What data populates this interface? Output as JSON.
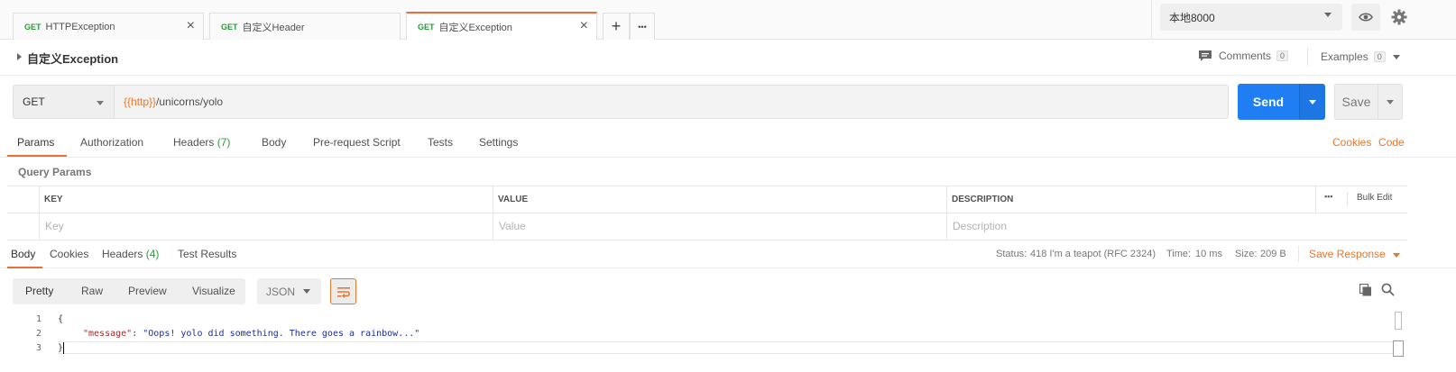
{
  "tabs": [
    {
      "method": "GET",
      "name": "HTTPException",
      "close": "×"
    },
    {
      "method": "GET",
      "name": "自定义Header"
    },
    {
      "method": "GET",
      "name": "自定义Exception",
      "close": "×"
    }
  ],
  "tab_controls": {
    "add": "+",
    "more": "•••"
  },
  "environment": {
    "selected": "本地8000"
  },
  "request": {
    "title": "自定义Exception",
    "comments_label": "Comments",
    "comments_count": "0",
    "examples_label": "Examples",
    "examples_count": "0",
    "method": "GET",
    "url_var": "{{http}}",
    "url_path": "/unicorns/yolo",
    "send_label": "Send",
    "save_label": "Save"
  },
  "request_tabs": {
    "params": "Params",
    "authorization": "Authorization",
    "headers": "Headers",
    "headers_count": "(7)",
    "body": "Body",
    "prerequest": "Pre-request Script",
    "tests": "Tests",
    "settings": "Settings",
    "cookies": "Cookies",
    "code": "Code"
  },
  "query_params": {
    "label": "Query Params",
    "columns": [
      "KEY",
      "VALUE",
      "DESCRIPTION"
    ],
    "placeholders": [
      "Key",
      "Value",
      "Description"
    ],
    "more": "•••",
    "bulk_edit": "Bulk Edit"
  },
  "response_tabs": {
    "body": "Body",
    "cookies": "Cookies",
    "headers": "Headers",
    "headers_count": "(4)",
    "test_results": "Test Results"
  },
  "response_status": {
    "status_label": "Status:",
    "status_value": "418 I'm a teapot (RFC 2324)",
    "time_label": "Time:",
    "time_value": "10 ms",
    "size_label": "Size:",
    "size_value": "209 B",
    "save_response": "Save Response"
  },
  "response_format": {
    "views": [
      "Pretty",
      "Raw",
      "Preview",
      "Visualize"
    ],
    "language": "JSON"
  },
  "response_body": {
    "line_numbers": [
      "1",
      "2",
      "3"
    ],
    "open_brace": "{",
    "key": "\"message\"",
    "colon": ": ",
    "value": "\"Oops! yolo did something. There goes a rainbow...\"",
    "close_brace": "}"
  },
  "colors": {
    "accent": "#f26b3a",
    "send_button": "#1f7ef3",
    "get_method": "#2a9a3c",
    "variable": "#e7772f"
  }
}
